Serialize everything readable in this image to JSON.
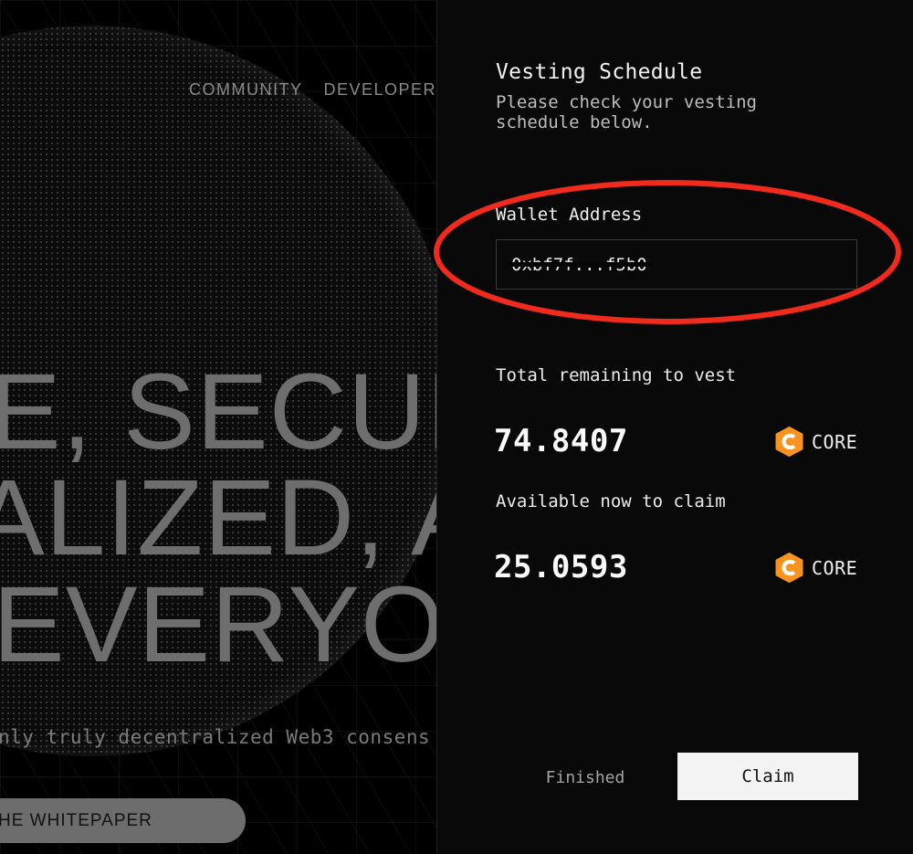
{
  "background_page": {
    "nav": [
      "COMMUNITY",
      "DEVELOPER"
    ],
    "hero_lines": [
      "E, SECUR",
      "ALIZED, A",
      "EVERYO"
    ],
    "tagline": "nly truly decentralized Web3 consens",
    "whitepaper_button": "HE WHITEPAPER"
  },
  "vesting_panel": {
    "title": "Vesting Schedule",
    "subtitle": "Please check your vesting schedule below.",
    "wallet": {
      "label": "Wallet Address",
      "value": "0xbf7f...f5b0",
      "redacted": true
    },
    "total_remaining": {
      "label": "Total remaining to vest",
      "value": "74.8407",
      "token": "CORE"
    },
    "available_now": {
      "label": "Available now to claim",
      "value": "25.0593",
      "token": "CORE"
    },
    "buttons": {
      "finished": "Finished",
      "claim": "Claim"
    }
  },
  "annotation": {
    "type": "ellipse-highlight",
    "target": "wallet-address-field",
    "color": "#f02a1c"
  },
  "colors": {
    "token_accent": "#f7931e",
    "panel_background": "#090909",
    "claim_button_bg": "#f3f3f3"
  }
}
